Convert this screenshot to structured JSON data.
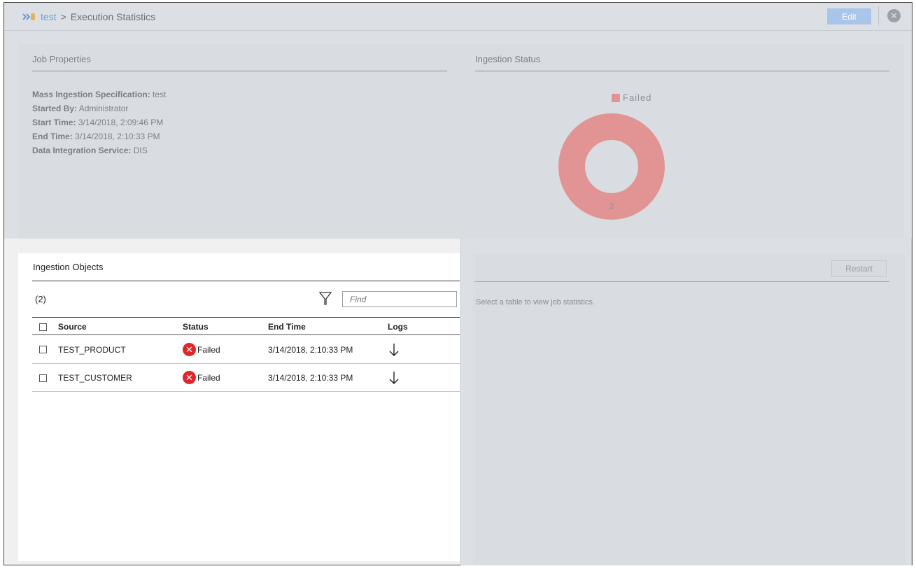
{
  "header": {
    "breadcrumb_link": "test",
    "breadcrumb_sep": ">",
    "breadcrumb_current": "Execution Statistics",
    "edit_label": "Edit",
    "close_glyph": "✕"
  },
  "job_properties": {
    "title": "Job Properties",
    "items": [
      {
        "label": "Mass Ingestion Specification:",
        "value": "test"
      },
      {
        "label": "Started By:",
        "value": "Administrator"
      },
      {
        "label": "Start Time:",
        "value": "3/14/2018, 2:09:46 PM"
      },
      {
        "label": "End Time:",
        "value": "3/14/2018, 2:10:33 PM"
      },
      {
        "label": "Data Integration Service:",
        "value": "DIS"
      }
    ]
  },
  "ingestion_status": {
    "title": "Ingestion Status",
    "legend_label": "Failed",
    "chart_value_label": "2",
    "color_failed": "#e29393"
  },
  "chart_data": {
    "type": "pie",
    "categories": [
      "Failed"
    ],
    "values": [
      2
    ],
    "title": "",
    "legend_position": "top"
  },
  "ingestion_objects": {
    "title": "Ingestion Objects",
    "count": "(2)",
    "find_placeholder": "Find",
    "columns": {
      "source": "Source",
      "status": "Status",
      "end_time": "End Time",
      "logs": "Logs"
    },
    "rows": [
      {
        "source": "TEST_PRODUCT",
        "status": "Failed",
        "end_time": "3/14/2018, 2:10:33 PM"
      },
      {
        "source": "TEST_CUSTOMER",
        "status": "Failed",
        "end_time": "3/14/2018, 2:10:33 PM"
      }
    ]
  },
  "details": {
    "restart_label": "Restart",
    "message": "Select a table to view job statistics."
  }
}
